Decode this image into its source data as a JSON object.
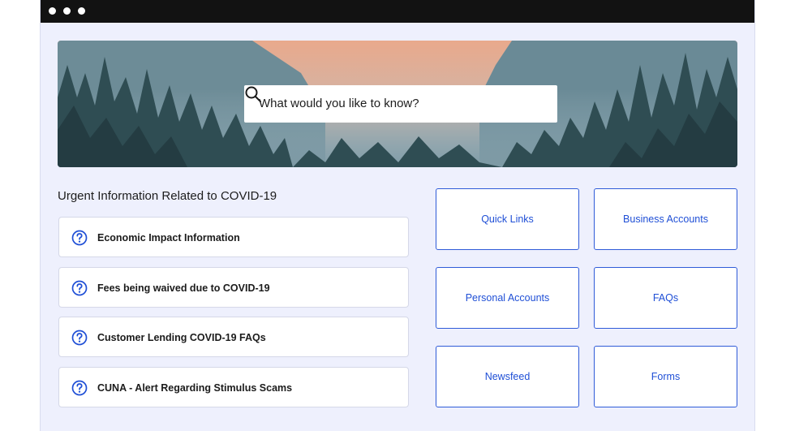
{
  "window": {
    "controls": [
      "dot",
      "dot",
      "dot"
    ]
  },
  "hero": {
    "search": {
      "placeholder": "What would you like to know?",
      "icon": "search-icon"
    }
  },
  "covid": {
    "title": "Urgent Information Related to COVID-19",
    "items": [
      {
        "label": "Economic Impact Information",
        "icon": "question-circle-icon"
      },
      {
        "label": "Fees being waived due to COVID-19",
        "icon": "question-circle-icon"
      },
      {
        "label": "Customer Lending COVID-19 FAQs",
        "icon": "question-circle-icon"
      },
      {
        "label": "CUNA - Alert Regarding Stimulus Scams",
        "icon": "question-circle-icon"
      }
    ]
  },
  "tiles": [
    {
      "label": "Quick Links"
    },
    {
      "label": "Business Accounts"
    },
    {
      "label": "Personal Accounts"
    },
    {
      "label": "FAQs"
    },
    {
      "label": "Newsfeed"
    },
    {
      "label": "Forms"
    }
  ],
  "colors": {
    "accent": "#1f4fd6",
    "page_bg": "#eef0fd",
    "titlebar": "#121212"
  }
}
